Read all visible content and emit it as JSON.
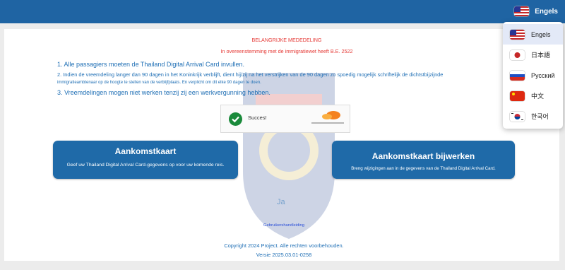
{
  "header": {
    "current_language": "Engels"
  },
  "notice": {
    "title": "BELANGRIJKE MEDEDELING",
    "subtitle": "In overeenstemming met de immigratiewet heeft B.E. 2522",
    "lines": [
      "1. Alle passagiers moeten de Thailand Digital Arrival Card invullen.",
      "2. Indien de vreemdeling langer dan 90 dagen in het Koninkrijk verblijft, dient hij/zij na het verstrijken van de 90 dagen zo spoedig mogelijk schriftelijk de dichtstbijzijnde",
      "immigratieambtenaar op de hoogte te stellen van de verblijfplaats. En verplicht om dit elke 90 dagen te doen.",
      "3. Vreemdelingen mogen niet werken tenzij zij een werkvergunning hebben."
    ]
  },
  "captcha": {
    "status": "Succes!"
  },
  "actions": {
    "arrival_card": {
      "title": "Aankomstkaart",
      "description": "Geef uw Thailand Digital Arrival Card-gegevens op voor uw komende reis."
    },
    "update_card": {
      "title": "Aankomstkaart bijwerken",
      "description": "Breng wijzigingen aan in de gegevens van de Thailand Digital Arrival Card."
    }
  },
  "watermark": "Ja",
  "footer": {
    "manual_link": "Gebruikershandleiding",
    "copyright": "Copyright 2024 Project. Alle rechten voorbehouden.",
    "version": "Versie 2025.03.01-0258"
  },
  "language_menu": {
    "items": [
      {
        "label": "Engels",
        "icon": "us-flag-icon"
      },
      {
        "label": "日本語",
        "icon": "japan-flag-icon"
      },
      {
        "label": "Русский",
        "icon": "russia-flag-icon"
      },
      {
        "label": "中文",
        "icon": "china-flag-icon"
      },
      {
        "label": "한국어",
        "icon": "korea-flag-icon"
      }
    ]
  },
  "colors": {
    "header_blue": "#1f64a3",
    "button_blue": "#1f6aa8",
    "notice_red": "#e53935",
    "text_blue": "#1f6fb5",
    "success_green": "#1a8a3b"
  }
}
